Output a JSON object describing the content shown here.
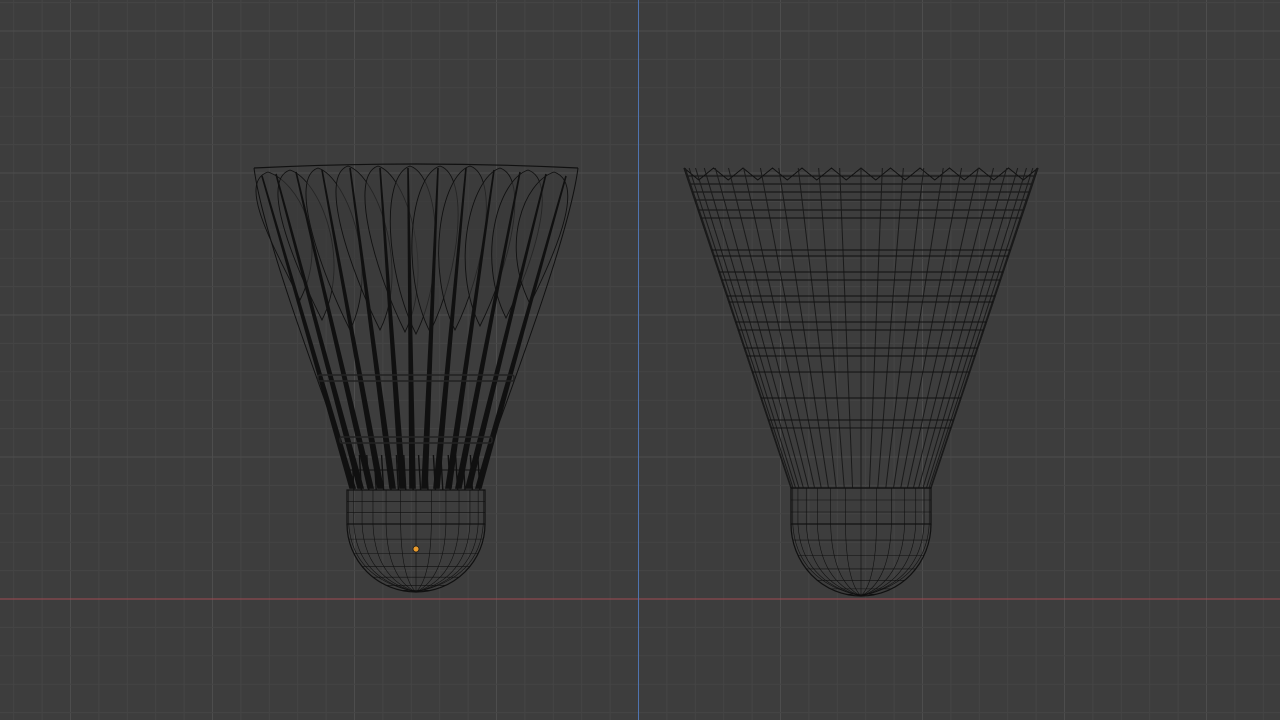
{
  "viewport": {
    "colors": {
      "background": "#3d3d3d",
      "grid_minor": "#454545",
      "grid_major": "#4d4d4d",
      "axis_x": "#a04a52",
      "axis_z": "#4f74b0",
      "wire": "#101010",
      "wire_dense": "#1a1a1a",
      "origin": "#e89a2c"
    },
    "objects": [
      {
        "name": "shuttlecock-feather",
        "shading": "wireframe"
      },
      {
        "name": "shuttlecock-synthetic",
        "shading": "wireframe"
      }
    ]
  }
}
